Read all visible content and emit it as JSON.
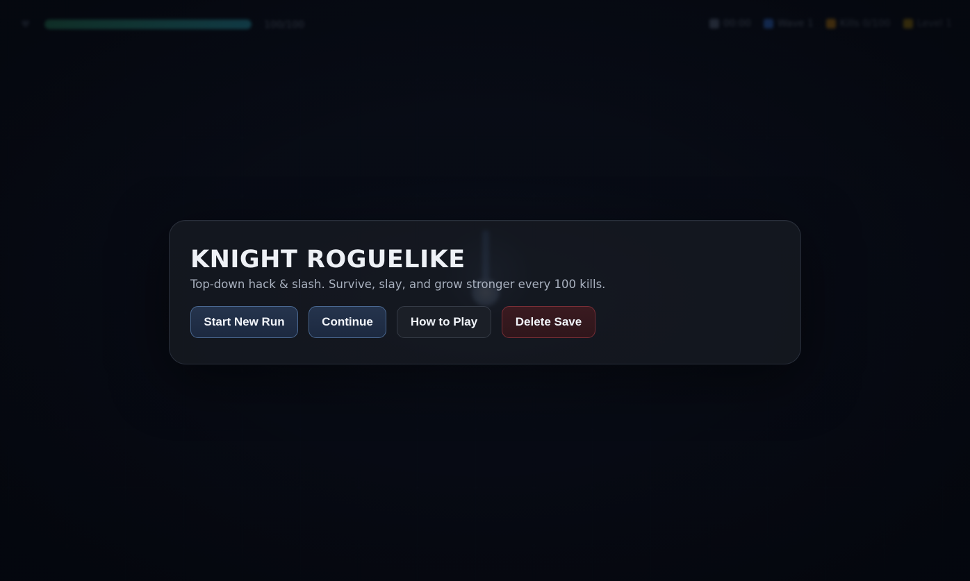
{
  "hud": {
    "hp_icon": "heart-icon",
    "hp_fill": 1.0,
    "hp_text": "100/100",
    "stats": [
      {
        "name": "time",
        "icon": "clock-icon",
        "value": "00:00"
      },
      {
        "name": "wave",
        "icon": "wave-icon",
        "value": "Wave 1"
      },
      {
        "name": "kills",
        "icon": "sword-icon",
        "value": "Kills 0/100"
      },
      {
        "name": "next",
        "icon": "star-icon",
        "value": "Level 1"
      }
    ]
  },
  "menu": {
    "title": "KNIGHT ROGUELIKE",
    "subtitle": "Top-down hack & slash. Survive, slay, and grow stronger every 100 kills.",
    "buttons": {
      "start": "Start New Run",
      "continue": "Continue",
      "how_to_play": "How to Play",
      "delete_save": "Delete Save"
    }
  },
  "colors": {
    "background": "#070b14",
    "panel": "#161a22",
    "primary_border": "#4a6891",
    "danger_border": "#7a2e36",
    "hp_start": "#3fcf8e",
    "hp_end": "#2fb5c9"
  }
}
